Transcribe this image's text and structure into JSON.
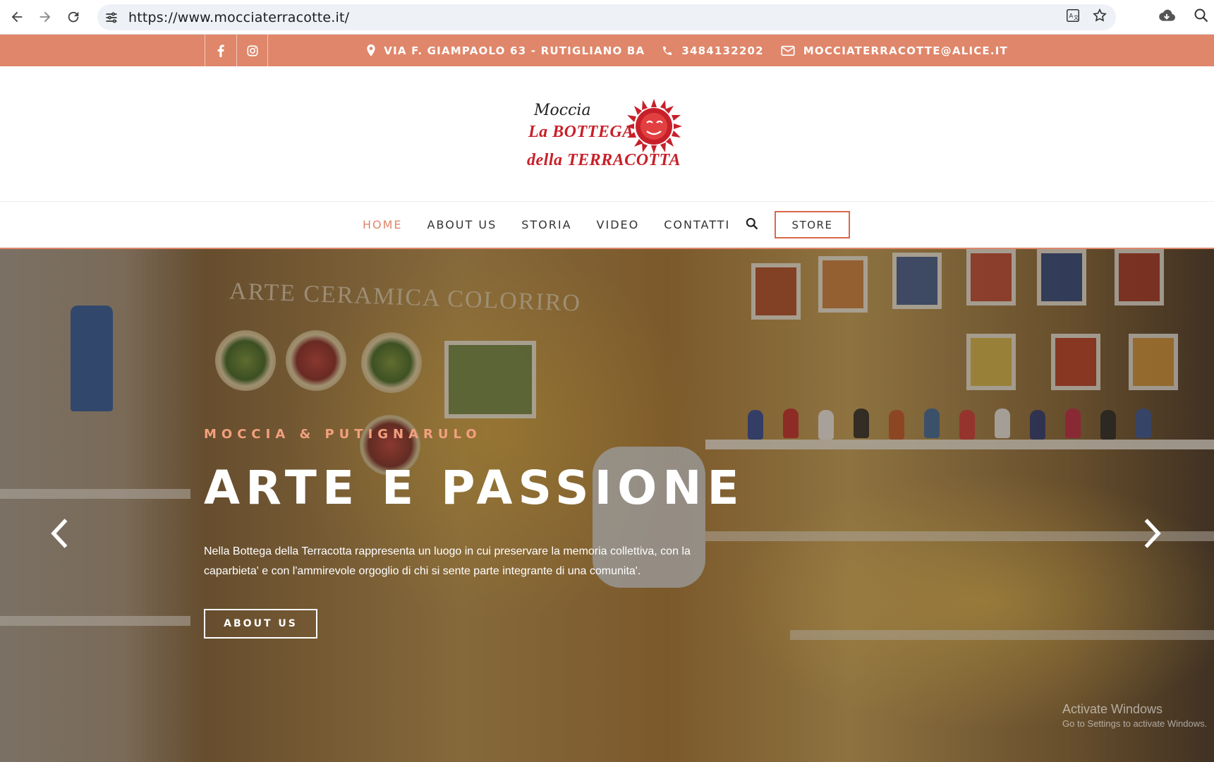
{
  "browser": {
    "url": "https://www.mocciaterracotte.it/"
  },
  "topbar": {
    "address": "VIA F. GIAMPAOLO 63 - RUTIGLIANO BA",
    "phone": "3484132202",
    "email": "MOCCIATERRACOTTE@ALICE.IT",
    "social": [
      "facebook-icon",
      "instagram-icon"
    ]
  },
  "logo": {
    "signature": "Moccia",
    "line1": "La BOTTEGA",
    "line2": "della TERRACOTTA"
  },
  "nav": {
    "items": [
      "HOME",
      "ABOUT US",
      "STORIA",
      "VIDEO",
      "CONTATTI"
    ],
    "active": "HOME",
    "store_label": "STORE"
  },
  "hero": {
    "sign": "ARTE  CERAMICA  COLORIRO",
    "kicker": "MOCCIA & PUTIGNARULO",
    "headline": "ARTE E PASSIONE",
    "description": "Nella Bottega della Terracotta rappresenta un luogo in cui preservare la memoria collettiva, con la caparbieta' e con l'ammirevole orgoglio di chi si sente parte integrante di una comunita'.",
    "button_label": "ABOUT US"
  },
  "watermark": {
    "line1": "Activate Windows",
    "line2": "Go to Settings to activate Windows."
  },
  "colors": {
    "accent": "#e0866a",
    "logo_red": "#c8202a",
    "kicker": "#f2a07e"
  }
}
